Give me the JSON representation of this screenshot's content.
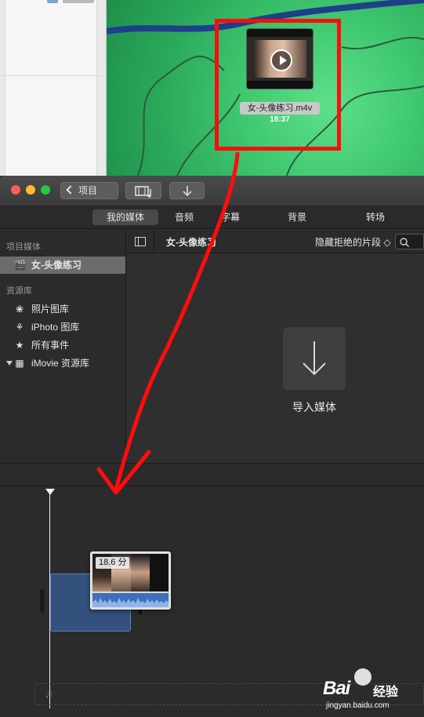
{
  "desktop": {
    "file_name": "女-头像练习.m4v",
    "file_duration": "18:37"
  },
  "toolbar": {
    "project_label": "项目",
    "media_icon": "film-music-icon",
    "import_icon": "download-arrow-icon"
  },
  "tabs": [
    {
      "label": "我的媒体",
      "selected": true
    },
    {
      "label": "音频"
    },
    {
      "label": "字幕"
    },
    {
      "label": "背景"
    },
    {
      "label": "转场"
    }
  ],
  "sidebar": {
    "project_media_header": "项目媒体",
    "project_item": "女-头像练习",
    "libraries_header": "资源库",
    "items": [
      {
        "label": "照片图库",
        "icon": "photos-icon"
      },
      {
        "label": "iPhoto 图库",
        "icon": "iphoto-palm-icon"
      },
      {
        "label": "所有事件",
        "icon": "star-icon"
      },
      {
        "label": "iMovie 资源库",
        "icon": "grid-icon"
      }
    ]
  },
  "browser": {
    "title": "女-头像练习",
    "filter_label": "隐藏拒绝的片段 ◇",
    "import_label": "导入媒体"
  },
  "timeline": {
    "clip_duration_badge": "18.6 分"
  },
  "watermark": {
    "brand": "经验",
    "logo": "Bai",
    "url": "jingyan.baidu.com"
  },
  "colors": {
    "annotation_red": "#ff0d0d",
    "selection_gray": "#6c6c6c",
    "drop_blue": "#34507d"
  }
}
